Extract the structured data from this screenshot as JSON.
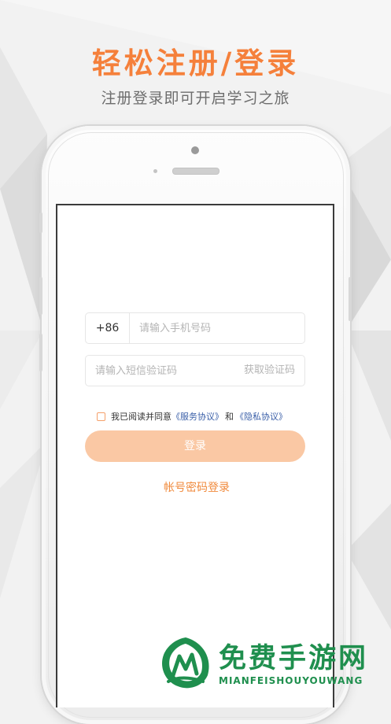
{
  "header": {
    "title": "轻松注册/登录",
    "subtitle": "注册登录即可开启学习之旅"
  },
  "login": {
    "country_code": "+86",
    "phone_placeholder": "请输入手机号码",
    "code_placeholder": "请输入短信验证码",
    "get_code_label": "获取验证码",
    "agree_prefix": "我已阅读并同意",
    "service_link": "《服务协议》",
    "and_text": "和",
    "privacy_link": "《隐私协议》",
    "agreed": false,
    "submit_label": "登录",
    "alt_login_label": "帐号密码登录"
  },
  "watermark": {
    "title": "免费手游网",
    "subtitle": "MIANFEISHOUYOUWANG",
    "logo_icon": "leaf-m-logo-icon"
  },
  "colors": {
    "accent": "#f5803b",
    "button_disabled": "#fac8a4",
    "link": "#3a5fa8",
    "watermark_green": "#1f8f4e"
  }
}
